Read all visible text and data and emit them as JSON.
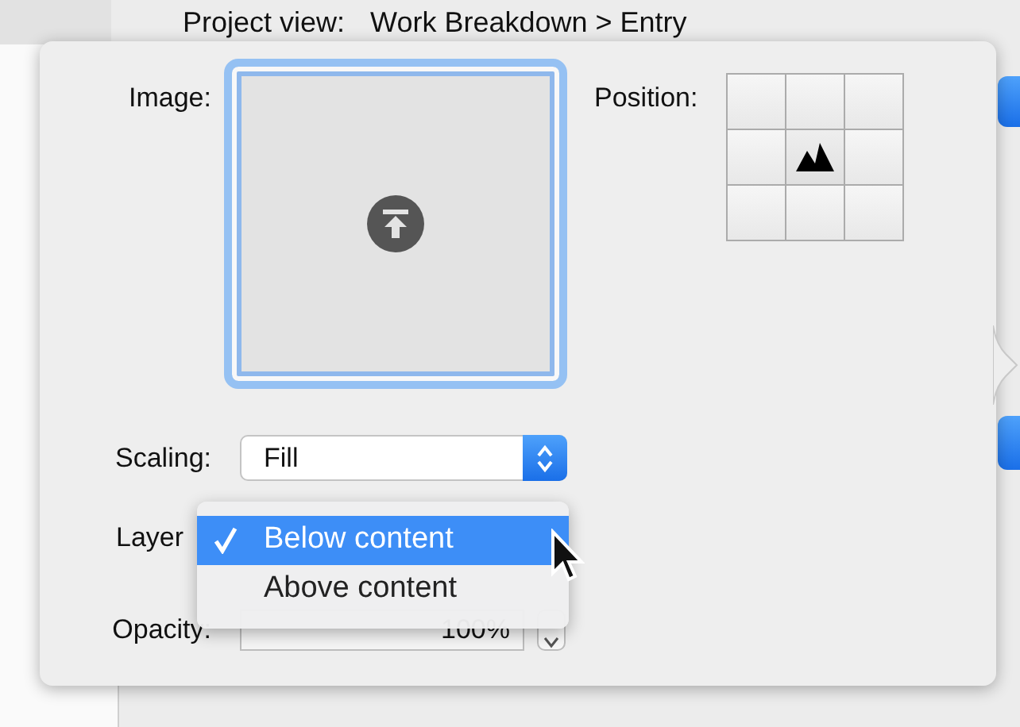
{
  "header": {
    "label": "Project view:",
    "value": "Work Breakdown > Entry"
  },
  "popover": {
    "image": {
      "label": "Image:"
    },
    "position": {
      "label": "Position:",
      "cells": [
        {
          "selected": false
        },
        {
          "selected": false
        },
        {
          "selected": false
        },
        {
          "selected": false
        },
        {
          "selected": true
        },
        {
          "selected": false
        },
        {
          "selected": false
        },
        {
          "selected": false
        },
        {
          "selected": false
        }
      ]
    },
    "scaling": {
      "label": "Scaling:",
      "value": "Fill"
    },
    "layer": {
      "label": "Layer",
      "menu": [
        {
          "label": "Below content",
          "selected": true,
          "checked": true
        },
        {
          "label": "Above content",
          "selected": false,
          "checked": false
        }
      ]
    },
    "opacity": {
      "label": "Opacity:",
      "value": "100%"
    }
  }
}
